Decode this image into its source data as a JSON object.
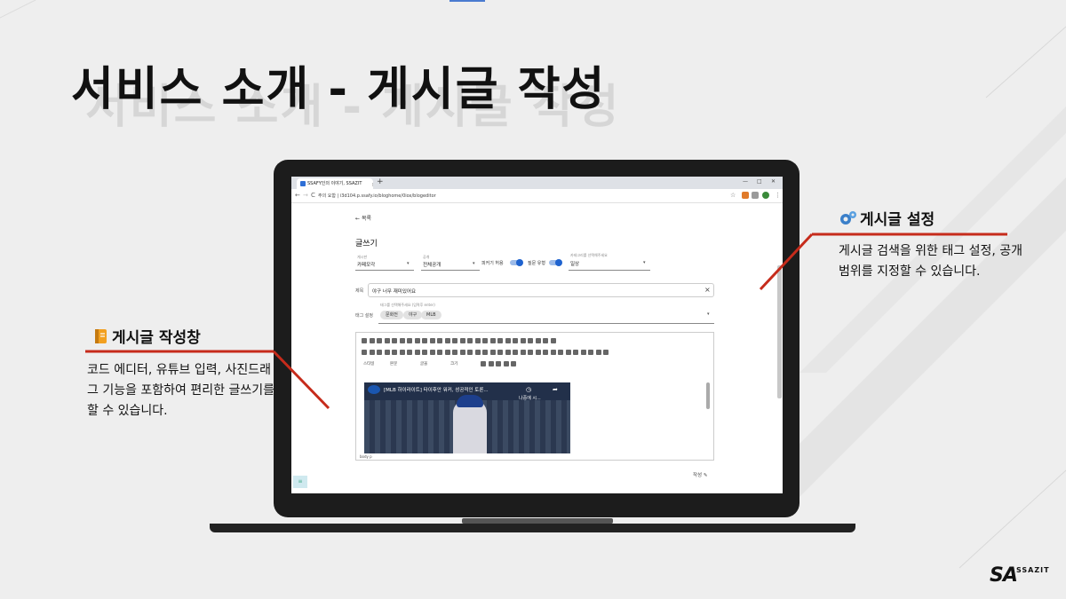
{
  "slide": {
    "title": "서비스 소개 - 게시글 작성"
  },
  "browser": {
    "tab_title": "SSAFY인의 이야기, SSAZIT",
    "tab_close": "×",
    "new_tab": "+",
    "win_min": "—",
    "win_max": "□",
    "win_close": "✕",
    "nav_back": "←",
    "nav_forward": "→",
    "nav_reload": "C",
    "address": "주의 요함 | i3d104.p.ssafy.io/bloghome/0iox/blogeditor",
    "star": "☆"
  },
  "editor_page": {
    "back_label": "목록",
    "heading": "글쓰기",
    "category": {
      "label": "게시판",
      "value": "카페모각"
    },
    "visibility": {
      "label": "공개",
      "value": "전체공개"
    },
    "toggle1_label": "피커기 허용",
    "toggle2_label": "질문 유형",
    "subcategory": {
      "label": "카테고리를 선택해주세요",
      "value": "일상"
    },
    "title_label": "제목",
    "title_value": "야구 너무 재미있어요",
    "title_clear": "×",
    "tag_label": "태그 설정",
    "tag_hint": "태그를 선택해주세요 (입력후 enter)",
    "tags": [
      "문화전",
      "야구",
      "MLB"
    ],
    "toolbar_selects": [
      "스타일",
      "본문",
      "글꼴",
      "크기"
    ],
    "video_title": "[MLB 하이라이트] 타이후안 워커, 성공적인 토론...",
    "video_sub": "나중에 시...",
    "editor_footer": "body p",
    "save_label": "작성"
  },
  "callout_left": {
    "heading": "게시글 작성창",
    "body": "코드 에디터, 유튜브 입력, 사진드래그 기능을 포함하여 편리한 글쓰기를 할 수 있습니다."
  },
  "callout_right": {
    "heading": "게시글 설정",
    "body": "게시글 검색을 위한 태그 설정, 공개 범위를 지정할 수 있습니다."
  },
  "logo": {
    "mark": "SA",
    "text": "SSAZIT"
  },
  "colors": {
    "accent_line": "#c62b1b",
    "toggle": "#1f63cf"
  }
}
